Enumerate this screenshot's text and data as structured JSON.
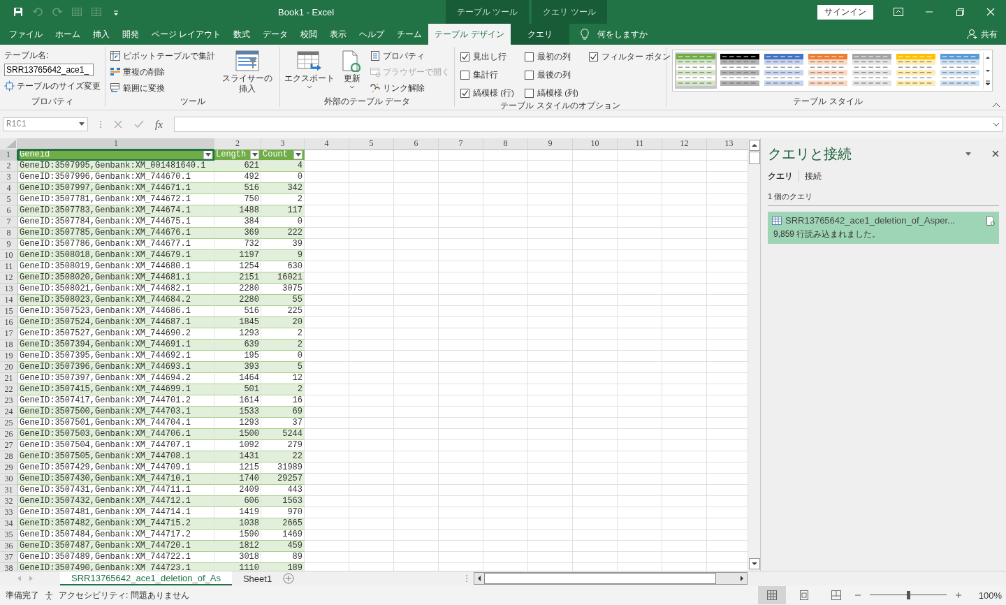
{
  "quick_access": [
    {
      "kind": "save",
      "disabled": false
    },
    {
      "kind": "undo",
      "disabled": true
    },
    {
      "kind": "redo",
      "disabled": true
    },
    {
      "kind": "grid",
      "disabled": true
    },
    {
      "kind": "grid2",
      "disabled": true
    },
    {
      "kind": "more",
      "disabled": false
    }
  ],
  "window": {
    "title": "Book1  -  Excel",
    "context_tabs": [
      {
        "label": "テーブル ツール"
      },
      {
        "label": "クエリ ツール"
      }
    ],
    "signin": "サインイン"
  },
  "menu_tabs": [
    {
      "label": "ファイル",
      "selected": false
    },
    {
      "label": "ホーム",
      "selected": false
    },
    {
      "label": "挿入",
      "selected": false
    },
    {
      "label": "開発",
      "selected": false
    },
    {
      "label": "ページ レイアウト",
      "selected": false
    },
    {
      "label": "数式",
      "selected": false
    },
    {
      "label": "データ",
      "selected": false
    },
    {
      "label": "校閲",
      "selected": false
    },
    {
      "label": "表示",
      "selected": false
    },
    {
      "label": "ヘルプ",
      "selected": false
    },
    {
      "label": "チーム",
      "selected": false
    },
    {
      "label": "テーブル デザイン",
      "selected": true
    },
    {
      "label": "クエリ",
      "selected": false
    }
  ],
  "tell_me": "何をしますか",
  "share": "共有",
  "ribbon": {
    "properties": {
      "caption": "テーブル名:",
      "table_name": "SRR13765642_ace1_",
      "resize": "テーブルのサイズ変更",
      "label": "プロパティ"
    },
    "tools": {
      "items": [
        {
          "kind": "pivot",
          "label": "ピボットテーブルで集計"
        },
        {
          "kind": "dedupe",
          "label": "重複の削除"
        },
        {
          "kind": "convert",
          "label": "範囲に変換"
        }
      ],
      "slicer": "スライサーの挿入",
      "label": "ツール"
    },
    "external": {
      "large": [
        {
          "kind": "export",
          "label": "エクスポート"
        },
        {
          "kind": "refresh",
          "label": "更新"
        }
      ],
      "items": [
        {
          "kind": "props",
          "label": "プロパティ",
          "disabled": false
        },
        {
          "kind": "browser",
          "label": "ブラウザーで開く",
          "disabled": true
        },
        {
          "kind": "unlink",
          "label": "リンク解除",
          "disabled": false
        }
      ],
      "label": "外部のテーブル データ"
    },
    "options": {
      "checkboxes": [
        {
          "kind": "header_row",
          "label": "見出し行",
          "checked": true
        },
        {
          "kind": "total_row",
          "label": "集計行",
          "checked": false
        },
        {
          "kind": "banded_rows",
          "label": "縞模様 (行)",
          "checked": true
        },
        {
          "kind": "first_col",
          "label": "最初の列",
          "checked": false
        },
        {
          "kind": "last_col",
          "label": "最後の列",
          "checked": false
        },
        {
          "kind": "banded_cols",
          "label": "縞模様 (列)",
          "checked": false
        },
        {
          "kind": "filter",
          "label": "フィルター ボタン",
          "checked": true
        }
      ],
      "label": "テーブル スタイルのオプション"
    },
    "styles": {
      "swatches": [
        {
          "color": "#70ad47",
          "selected": true
        },
        {
          "color": "#000000",
          "selected": false
        },
        {
          "color": "#4472c4",
          "selected": false
        },
        {
          "color": "#ed7d31",
          "selected": false
        },
        {
          "color": "#a5a5a5",
          "selected": false
        },
        {
          "color": "#ffc000",
          "selected": false
        },
        {
          "color": "#5b9bd5",
          "selected": false
        }
      ],
      "label": "テーブル スタイル"
    }
  },
  "formula_bar": {
    "name_box": "R1C1",
    "fx": "fx"
  },
  "sheet": {
    "columns": [
      {
        "label": "1",
        "selected": true
      },
      {
        "label": "2",
        "selected": false
      },
      {
        "label": "3",
        "selected": false
      },
      {
        "label": "4",
        "selected": false
      },
      {
        "label": "5",
        "selected": false
      },
      {
        "label": "6",
        "selected": false
      },
      {
        "label": "7",
        "selected": false
      },
      {
        "label": "8",
        "selected": false
      },
      {
        "label": "9",
        "selected": false
      },
      {
        "label": "10",
        "selected": false
      },
      {
        "label": "11",
        "selected": false
      },
      {
        "label": "12",
        "selected": false
      },
      {
        "label": "13",
        "selected": false
      }
    ],
    "header_row": {
      "n": "1",
      "selected": true,
      "cells": [
        "Geneid",
        "Length",
        "Count"
      ]
    },
    "rows": [
      {
        "n": "2",
        "cells": [
          "GeneID:3507995,Genbank:XM_001481640.1",
          "621",
          "4"
        ]
      },
      {
        "n": "3",
        "cells": [
          "GeneID:3507996,Genbank:XM_744670.1",
          "492",
          "0"
        ]
      },
      {
        "n": "4",
        "cells": [
          "GeneID:3507997,Genbank:XM_744671.1",
          "516",
          "342"
        ]
      },
      {
        "n": "5",
        "cells": [
          "GeneID:3507781,Genbank:XM_744672.1",
          "750",
          "2"
        ]
      },
      {
        "n": "6",
        "cells": [
          "GeneID:3507783,Genbank:XM_744674.1",
          "1488",
          "117"
        ]
      },
      {
        "n": "7",
        "cells": [
          "GeneID:3507784,Genbank:XM_744675.1",
          "384",
          "0"
        ]
      },
      {
        "n": "8",
        "cells": [
          "GeneID:3507785,Genbank:XM_744676.1",
          "369",
          "222"
        ]
      },
      {
        "n": "9",
        "cells": [
          "GeneID:3507786,Genbank:XM_744677.1",
          "732",
          "39"
        ]
      },
      {
        "n": "10",
        "cells": [
          "GeneID:3508018,Genbank:XM_744679.1",
          "1197",
          "9"
        ]
      },
      {
        "n": "11",
        "cells": [
          "GeneID:3508019,Genbank:XM_744680.1",
          "1254",
          "630"
        ]
      },
      {
        "n": "12",
        "cells": [
          "GeneID:3508020,Genbank:XM_744681.1",
          "2151",
          "16021"
        ]
      },
      {
        "n": "13",
        "cells": [
          "GeneID:3508021,Genbank:XM_744682.1",
          "2280",
          "3075"
        ]
      },
      {
        "n": "14",
        "cells": [
          "GeneID:3508023,Genbank:XM_744684.2",
          "2280",
          "55"
        ]
      },
      {
        "n": "15",
        "cells": [
          "GeneID:3507523,Genbank:XM_744686.1",
          "516",
          "225"
        ]
      },
      {
        "n": "16",
        "cells": [
          "GeneID:3507524,Genbank:XM_744687.1",
          "1845",
          "20"
        ]
      },
      {
        "n": "17",
        "cells": [
          "GeneID:3507527,Genbank:XM_744690.2",
          "1293",
          "2"
        ]
      },
      {
        "n": "18",
        "cells": [
          "GeneID:3507394,Genbank:XM_744691.1",
          "639",
          "2"
        ]
      },
      {
        "n": "19",
        "cells": [
          "GeneID:3507395,Genbank:XM_744692.1",
          "195",
          "0"
        ]
      },
      {
        "n": "20",
        "cells": [
          "GeneID:3507396,Genbank:XM_744693.1",
          "393",
          "5"
        ]
      },
      {
        "n": "21",
        "cells": [
          "GeneID:3507397,Genbank:XM_744694.2",
          "1464",
          "12"
        ]
      },
      {
        "n": "22",
        "cells": [
          "GeneID:3507415,Genbank:XM_744699.1",
          "501",
          "2"
        ]
      },
      {
        "n": "23",
        "cells": [
          "GeneID:3507417,Genbank:XM_744701.2",
          "1614",
          "16"
        ]
      },
      {
        "n": "24",
        "cells": [
          "GeneID:3507500,Genbank:XM_744703.1",
          "1533",
          "69"
        ]
      },
      {
        "n": "25",
        "cells": [
          "GeneID:3507501,Genbank:XM_744704.1",
          "1293",
          "37"
        ]
      },
      {
        "n": "26",
        "cells": [
          "GeneID:3507503,Genbank:XM_744706.1",
          "1500",
          "5244"
        ]
      },
      {
        "n": "27",
        "cells": [
          "GeneID:3507504,Genbank:XM_744707.1",
          "1092",
          "279"
        ]
      },
      {
        "n": "28",
        "cells": [
          "GeneID:3507505,Genbank:XM_744708.1",
          "1431",
          "22"
        ]
      },
      {
        "n": "29",
        "cells": [
          "GeneID:3507429,Genbank:XM_744709.1",
          "1215",
          "31989"
        ]
      },
      {
        "n": "30",
        "cells": [
          "GeneID:3507430,Genbank:XM_744710.1",
          "1740",
          "29257"
        ]
      },
      {
        "n": "31",
        "cells": [
          "GeneID:3507431,Genbank:XM_744711.1",
          "2409",
          "443"
        ]
      },
      {
        "n": "32",
        "cells": [
          "GeneID:3507432,Genbank:XM_744712.1",
          "606",
          "1563"
        ]
      },
      {
        "n": "33",
        "cells": [
          "GeneID:3507481,Genbank:XM_744714.1",
          "1419",
          "970"
        ]
      },
      {
        "n": "34",
        "cells": [
          "GeneID:3507482,Genbank:XM_744715.2",
          "1038",
          "2665"
        ]
      },
      {
        "n": "35",
        "cells": [
          "GeneID:3507484,Genbank:XM_744717.2",
          "1590",
          "1469"
        ]
      },
      {
        "n": "36",
        "cells": [
          "GeneID:3507487,Genbank:XM_744720.1",
          "1812",
          "459"
        ]
      },
      {
        "n": "37",
        "cells": [
          "GeneID:3507489,Genbank:XM_744722.1",
          "3018",
          "89"
        ]
      },
      {
        "n": "38",
        "cells": [
          "GeneID:3507490,Genbank:XM_744723.1",
          "1110",
          "189"
        ]
      }
    ]
  },
  "sheet_tabs": [
    {
      "label": "SRR13765642_ace1_deletion_of_As",
      "selected": true
    },
    {
      "label": "Sheet1",
      "selected": false
    }
  ],
  "queries_pane": {
    "title": "クエリと接続",
    "tabs": [
      {
        "label": "クエリ",
        "selected": true
      },
      {
        "label": "接続",
        "selected": false
      }
    ],
    "count": "1 個のクエリ",
    "query": {
      "name": "SRR13765642_ace1_deletion_of_Asper...",
      "status": "9,859 行読み込まれました。"
    }
  },
  "status_bar": {
    "ready": "準備完了",
    "accessibility": "アクセシビリティ: 問題ありません",
    "views": [
      {
        "kind": "normal",
        "selected": true
      },
      {
        "kind": "page_layout",
        "selected": false
      },
      {
        "kind": "page_break",
        "selected": false
      }
    ],
    "zoom": {
      "level": 0.5,
      "label": "100%"
    }
  }
}
